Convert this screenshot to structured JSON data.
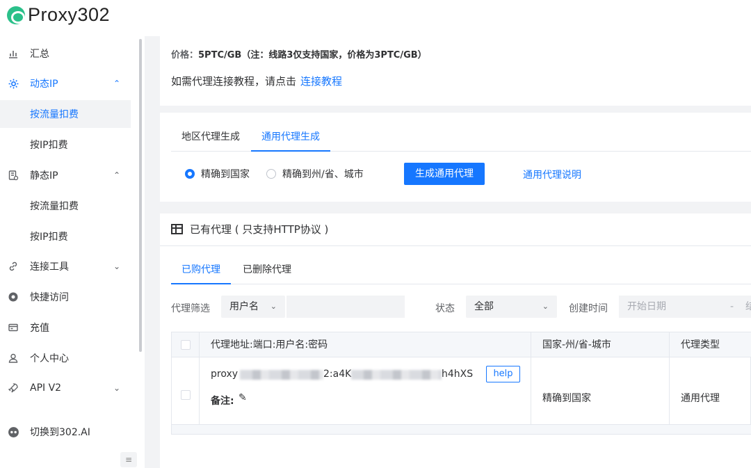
{
  "brand": {
    "logo_text": "Proxy302"
  },
  "sidebar": {
    "items": [
      {
        "label": "汇总",
        "icon": "bar-chart-icon"
      },
      {
        "label": "动态IP",
        "icon": "gear-icon",
        "chevron": "⌃"
      },
      {
        "label": "按流量扣费"
      },
      {
        "label": "按IP扣费"
      },
      {
        "label": "静态IP",
        "icon": "server-icon",
        "chevron": "⌃"
      },
      {
        "label": "按流量扣费"
      },
      {
        "label": "按IP扣费"
      },
      {
        "label": "连接工具",
        "icon": "link-icon",
        "chevron": "⌄"
      },
      {
        "label": "快捷访问",
        "icon": "chrome-icon"
      },
      {
        "label": "充值",
        "icon": "wallet-icon"
      },
      {
        "label": "个人中心",
        "icon": "user-icon"
      },
      {
        "label": "API V2",
        "icon": "rocket-icon",
        "chevron": "⌄"
      },
      {
        "label": "切换到302.AI",
        "icon": "switch-icon"
      }
    ],
    "collapse_icon": "≡"
  },
  "price_card": {
    "price_label": "价格：",
    "price_value": "5PTC/GB（注：线路3仅支持国家，价格为3PTC/GB）",
    "tutorial_text": "如需代理连接教程，请点击",
    "tutorial_link": "连接教程"
  },
  "generate_card": {
    "tabs": [
      "地区代理生成",
      "通用代理生成"
    ],
    "radios": [
      "精确到国家",
      "精确到州/省、城市"
    ],
    "generate_button": "生成通用代理",
    "explain_link": "通用代理说明"
  },
  "proxy_card": {
    "title": "已有代理 ( 只支持HTTP协议 )",
    "tabs": [
      "已购代理",
      "已删除代理"
    ],
    "filter_label": "代理筛选",
    "filter_field": "用户名",
    "status_label": "状态",
    "status_value": "全部",
    "created_label": "创建时间",
    "start_date_placeholder": "开始日期",
    "date_sep": "-",
    "end_date_placeholder": "结",
    "table": {
      "headers": [
        "代理地址:端口:用户名:密码",
        "国家-州/省-城市",
        "代理类型"
      ],
      "rows": [
        {
          "addr_start": "proxy",
          "addr_mid": "2:a4K",
          "addr_end": "h4hXS",
          "help": "help",
          "note_label": "备注:",
          "region": "精确到国家",
          "type": "通用代理"
        }
      ]
    }
  }
}
